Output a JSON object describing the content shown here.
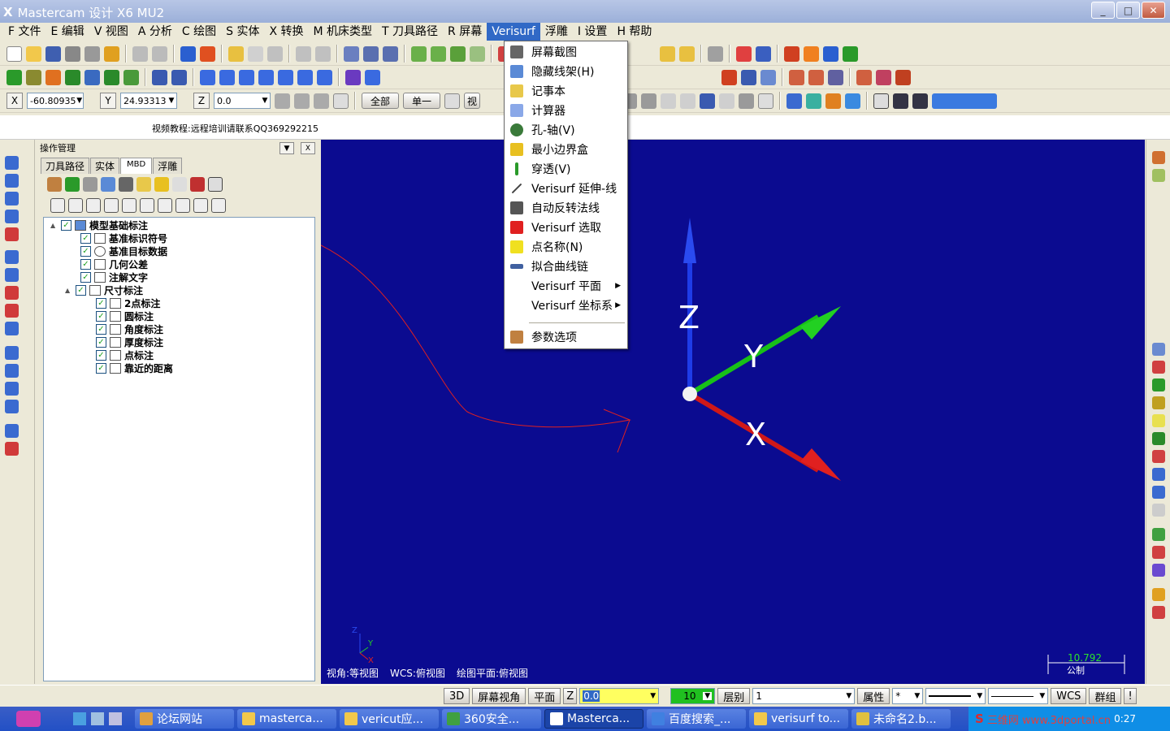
{
  "window": {
    "title": "Mastercam 设计 X6 MU2",
    "app_glyph": "X"
  },
  "menu": [
    "F 文件",
    "E 编辑",
    "V 视图",
    "A 分析",
    "C 绘图",
    "S 实体",
    "X 转换",
    "M 机床类型",
    "T 刀具路径",
    "R 屏幕",
    "Verisurf",
    "浮雕",
    "I 设置",
    "H 帮助"
  ],
  "coords": {
    "x_label": "X",
    "x_value": "-60.80935",
    "y_label": "Y",
    "y_value": "24.93313",
    "z_label": "Z",
    "z_value": "0.0"
  },
  "toolbar": {
    "all_label": "全部",
    "single_label": "单一",
    "view_label": "视"
  },
  "info": {
    "text": "视频教程:远程培训请联系QQ369292215"
  },
  "opmgr": {
    "title": "操作管理",
    "tabs": [
      "刀具路径",
      "实体",
      "MBD",
      "浮雕"
    ]
  },
  "tree": [
    {
      "label": "模型基础标注",
      "level": 0,
      "expander": "▲"
    },
    {
      "label": "基准标识符号",
      "level": 1
    },
    {
      "label": "基准目标数据",
      "level": 1
    },
    {
      "label": "几何公差",
      "level": 1
    },
    {
      "label": "注解文字",
      "level": 1
    },
    {
      "label": "尺寸标注",
      "level": 1,
      "expander": "▲"
    },
    {
      "label": "2点标注",
      "level": 2
    },
    {
      "label": "圆标注",
      "level": 2
    },
    {
      "label": "角度标注",
      "level": 2
    },
    {
      "label": "厚度标注",
      "level": 2
    },
    {
      "label": "点标注",
      "level": 2
    },
    {
      "label": "靠近的距离",
      "level": 2
    }
  ],
  "dropdown": [
    {
      "label": "屏幕截图",
      "icon": "screenshot-icon",
      "color": "#666666"
    },
    {
      "label": "隐藏线架(H)",
      "icon": "cube-icon",
      "color": "#5a8ad6"
    },
    {
      "label": "记事本",
      "icon": "notepad-icon",
      "color": "#e8c84a"
    },
    {
      "label": "计算器",
      "icon": "calculator-icon",
      "color": "#8aa8e8"
    },
    {
      "label": "孔-轴(V)",
      "icon": "hole-shaft-icon",
      "color": "#3a7a3a"
    },
    {
      "label": "最小边界盒",
      "icon": "bounding-box-icon",
      "color": "#e8c020"
    },
    {
      "label": "穿透(V)",
      "icon": "pierce-icon",
      "color": "#2a9a2a"
    },
    {
      "label": "Verisurf 延伸-线",
      "icon": "line-extend-icon",
      "color": "#444444"
    },
    {
      "label": "自动反转法线",
      "icon": "flip-normal-icon",
      "color": "#555555"
    },
    {
      "label": "Verisurf 选取",
      "icon": "lightning-icon",
      "color": "#e02020"
    },
    {
      "label": "点名称(N)",
      "icon": "point-name-icon",
      "color": "#f0e020"
    },
    {
      "label": "拟合曲线链",
      "icon": "curve-fit-icon",
      "color": "#4060a0"
    },
    {
      "label": "Verisurf 平面",
      "icon": "",
      "color": "#ffffff",
      "submenu": "▶"
    },
    {
      "label": "Verisurf 坐标系",
      "icon": "",
      "color": "#ffffff",
      "submenu": "▶"
    },
    {
      "label": "参数选项",
      "icon": "settings-icon",
      "color": "#c08040"
    }
  ],
  "viewport": {
    "axis_z": "Z",
    "axis_y": "Y",
    "axis_x": "X",
    "status_view": "视角:等视图",
    "status_wcs": "WCS:俯视图",
    "status_plane": "绘图平面:俯视图",
    "scale_value": "10.792",
    "scale_unit": "公制",
    "mini_z": "Z",
    "mini_y": "Y",
    "mini_x": "X",
    "colors": {
      "background": "#0b0b90",
      "x_axis": "#d01818",
      "y_axis": "#18c018",
      "z_axis": "#1e3ce8",
      "annotation": "#e02020"
    }
  },
  "status": {
    "btn_3d": "3D",
    "btn_screen_view": "屏幕视角",
    "btn_plane": "平面",
    "z_label": "Z",
    "z_value": "0.0",
    "level_value": "10",
    "level_label": "层别",
    "level_field": "1",
    "attr_label": "属性",
    "attr_value": "*",
    "wcs_label": "WCS",
    "group_label": "群组",
    "bang": "!"
  },
  "taskbar": [
    {
      "label": "论坛网站",
      "icon": "forum-icon"
    },
    {
      "label": "masterca...",
      "icon": "folder-icon"
    },
    {
      "label": "vericut应...",
      "icon": "folder-icon"
    },
    {
      "label": "360安全...",
      "icon": "browser-icon"
    },
    {
      "label": "Masterca...",
      "icon": "mastercam-icon",
      "active": true
    },
    {
      "label": "百度搜索_...",
      "icon": "browser-icon"
    },
    {
      "label": "verisurf to...",
      "icon": "folder-icon"
    },
    {
      "label": "未命名2.b...",
      "icon": "paint-icon"
    }
  ],
  "tray": {
    "brand": "S",
    "watermark": "三维网 www.3dportal.cn",
    "time": "0:27"
  }
}
